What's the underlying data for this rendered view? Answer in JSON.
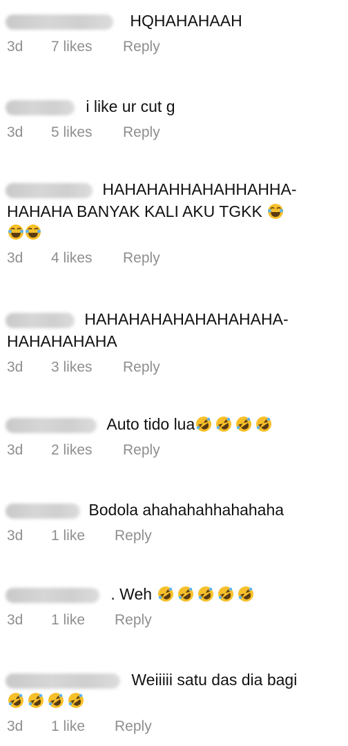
{
  "comments": [
    {
      "text": "HQHAHAHAAH",
      "continuation": "",
      "time": "3d",
      "likes": "7 likes",
      "reply": "Reply"
    },
    {
      "text": "i like ur cut g",
      "continuation": "",
      "time": "3d",
      "likes": "5 likes",
      "reply": "Reply"
    },
    {
      "text": "HAHAHAHHAHAHHAHHA-",
      "continuation": "HAHAHA BANYAK KALI AKU TGKK",
      "time": "3d",
      "likes": "4 likes",
      "reply": "Reply",
      "emoji": "face-with-tears-of-joy"
    },
    {
      "text": "HAHAHAHAHAHAHAHAHA-",
      "continuation": "HAHAHAHAHA",
      "time": "3d",
      "likes": "3 likes",
      "reply": "Reply"
    },
    {
      "text": "Auto tido lua",
      "continuation": "",
      "time": "3d",
      "likes": "2 likes",
      "reply": "Reply",
      "emoji": "rolling-on-floor-laughing"
    },
    {
      "text": "Bodola ahahahahhahahaha",
      "continuation": "",
      "time": "3d",
      "likes": "1 like",
      "reply": "Reply"
    },
    {
      "text": ". Weh",
      "continuation": "",
      "time": "3d",
      "likes": "1 like",
      "reply": "Reply",
      "emoji": "rolling-on-floor-laughing"
    },
    {
      "text": "Weiiiii satu das dia bagi",
      "continuation": "",
      "time": "3d",
      "likes": "1 like",
      "reply": "Reply",
      "emoji": "rolling-on-floor-laughing"
    }
  ],
  "colors": {
    "text": "#111111",
    "meta": "#8e8e8e",
    "emoji_face": "#f7c02b"
  }
}
